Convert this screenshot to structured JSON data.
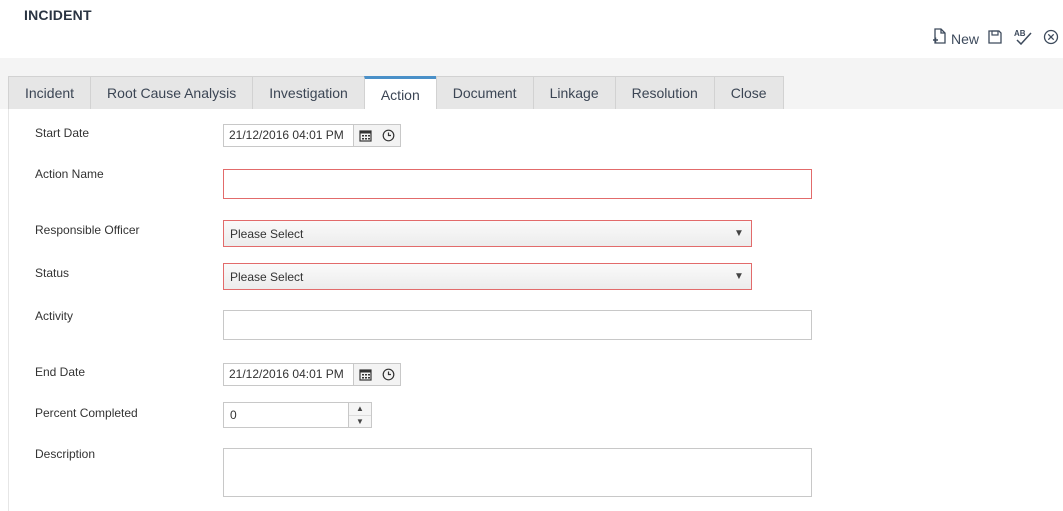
{
  "header": {
    "title": "INCIDENT"
  },
  "toolbar": {
    "new_label": "New",
    "icons": [
      "new-document-icon",
      "save-icon",
      "spellcheck-icon",
      "close-icon"
    ]
  },
  "tabs": [
    {
      "label": "Incident"
    },
    {
      "label": "Root Cause Analysis"
    },
    {
      "label": "Investigation"
    },
    {
      "label": "Action",
      "active": true
    },
    {
      "label": "Document"
    },
    {
      "label": "Linkage"
    },
    {
      "label": "Resolution"
    },
    {
      "label": "Close"
    }
  ],
  "form": {
    "start_date": {
      "label": "Start Date",
      "value": "21/12/2016 04:01 PM"
    },
    "action_name": {
      "label": "Action Name",
      "value": ""
    },
    "responsible_officer": {
      "label": "Responsible Officer",
      "value": "Please Select"
    },
    "status": {
      "label": "Status",
      "value": "Please Select"
    },
    "activity": {
      "label": "Activity",
      "value": ""
    },
    "end_date": {
      "label": "End Date",
      "value": "21/12/2016 04:01 PM"
    },
    "percent_completed": {
      "label": "Percent Completed",
      "value": "0"
    },
    "description": {
      "label": "Description",
      "value": ""
    }
  },
  "colors": {
    "required_border": "#e26b6b",
    "active_tab_accent": "#4a90c8",
    "tab_background": "#e6e6e6",
    "tabbar_background": "#f4f4f4",
    "title_color": "#2a3442"
  }
}
